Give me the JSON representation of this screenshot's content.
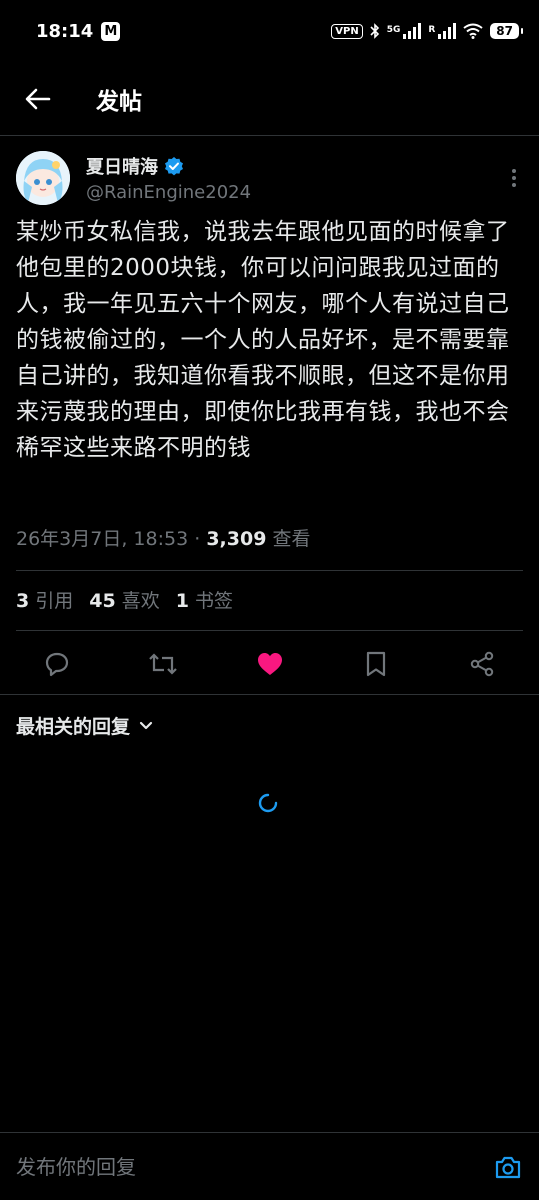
{
  "status_bar": {
    "time": "18:14",
    "mail_icon_letter": "M",
    "vpn_label": "VPN",
    "network_label": "5G",
    "roaming_label": "R",
    "battery": "87"
  },
  "header": {
    "title": "发帖"
  },
  "post": {
    "author_name": "夏日晴海",
    "author_handle": "@RainEngine2024",
    "text": "某炒币女私信我，说我去年跟他见面的时候拿了他包里的2000块钱，你可以问问跟我见过面的人，我一年见五六十个网友，哪个人有说过自己的钱被偷过的，一个人的人品好坏，是不需要靠自己讲的，我知道你看我不顺眼，但这不是你用来污蔑我的理由，即使你比我再有钱，我也不会稀罕这些来路不明的钱",
    "timestamp": "26年3月7日, 18:53 · ",
    "views_count": "3,309",
    "views_label": " 查看"
  },
  "stats": {
    "quotes_count": "3",
    "quotes_label": "引用",
    "likes_count": "45",
    "likes_label": "喜欢",
    "bookmarks_count": "1",
    "bookmarks_label": "书签"
  },
  "actions": [
    "reply-icon",
    "repost-icon",
    "like-icon",
    "bookmark-icon",
    "share-icon"
  ],
  "colors": {
    "like_active": "#f91880",
    "accent": "#1d9bf0",
    "muted": "#71767b",
    "divider": "#2f3336"
  },
  "replies": {
    "sort_label": "最相关的回复"
  },
  "reply_bar": {
    "placeholder": "发布你的回复"
  }
}
